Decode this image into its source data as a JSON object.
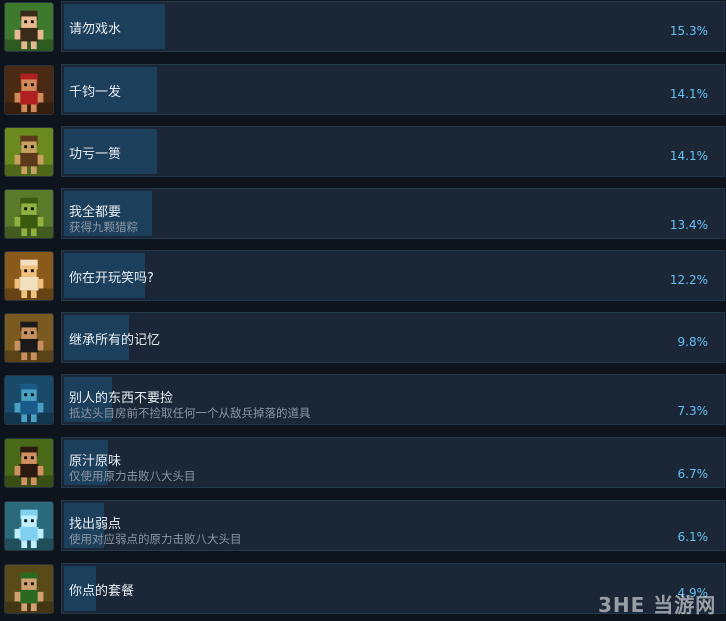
{
  "achievements": [
    {
      "title": "请勿戏水",
      "desc": "",
      "percent": "15.3%",
      "fill": 0.153,
      "icon": "swimming-kid-icon",
      "bg": "#3e7a2e"
    },
    {
      "title": "千钧一发",
      "desc": "",
      "percent": "14.1%",
      "fill": 0.141,
      "icon": "red-monster-icon",
      "bg": "#4a2a12"
    },
    {
      "title": "功亏一篑",
      "desc": "",
      "percent": "14.1%",
      "fill": 0.141,
      "icon": "goblin-lord-icon",
      "bg": "#6a8a20"
    },
    {
      "title": "我全都要",
      "desc": "获得九颗猎粽",
      "percent": "13.4%",
      "fill": 0.134,
      "icon": "rice-dumpling-icon",
      "bg": "#5a7a2a"
    },
    {
      "title": "你在开玩笑吗?",
      "desc": "",
      "percent": "12.2%",
      "fill": 0.122,
      "icon": "mouse-creature-icon",
      "bg": "#8a5a1a"
    },
    {
      "title": "继承所有的记忆",
      "desc": "",
      "percent": "9.8%",
      "fill": 0.098,
      "icon": "dark-haired-warrior-icon",
      "bg": "#7a5a20"
    },
    {
      "title": "别人的东西不要捡",
      "desc": "抵达头目房前不捡取任何一个从敌兵掉落的道具",
      "percent": "7.3%",
      "fill": 0.073,
      "icon": "blue-beast-icon",
      "bg": "#1a4a6a"
    },
    {
      "title": "原汁原味",
      "desc": "仅使用原力击败八大头目",
      "percent": "6.7%",
      "fill": 0.067,
      "icon": "caveman-icon",
      "bg": "#4a6a1a"
    },
    {
      "title": "找出弱点",
      "desc": "使用对应弱点的原力击败八大头目",
      "percent": "6.1%",
      "fill": 0.061,
      "icon": "ice-spirit-icon",
      "bg": "#2a6a7a"
    },
    {
      "title": "你点的套餐",
      "desc": "",
      "percent": "4.9%",
      "fill": 0.049,
      "icon": "tribal-chief-icon",
      "bg": "#5a4a1a"
    }
  ],
  "watermark": "3HE 当游网"
}
